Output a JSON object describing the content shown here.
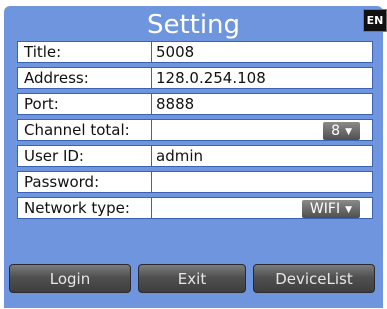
{
  "header": {
    "title": "Setting",
    "language_badge": "EN"
  },
  "form": {
    "title": {
      "label": "Title:",
      "value": "5008"
    },
    "address": {
      "label": "Address:",
      "value": "128.0.254.108"
    },
    "port": {
      "label": "Port:",
      "value": "8888"
    },
    "channel_total": {
      "label": "Channel total:",
      "value": "8"
    },
    "user_id": {
      "label": "User ID:",
      "value": "admin"
    },
    "password": {
      "label": "Password:",
      "value": ""
    },
    "network_type": {
      "label": "Network type:",
      "value": "WIFI"
    }
  },
  "buttons": {
    "login": "Login",
    "exit": "Exit",
    "device_list": "DeviceList"
  },
  "colors": {
    "panel": "#6f95de",
    "field_border": "#3b63b3",
    "button": "#505050"
  }
}
